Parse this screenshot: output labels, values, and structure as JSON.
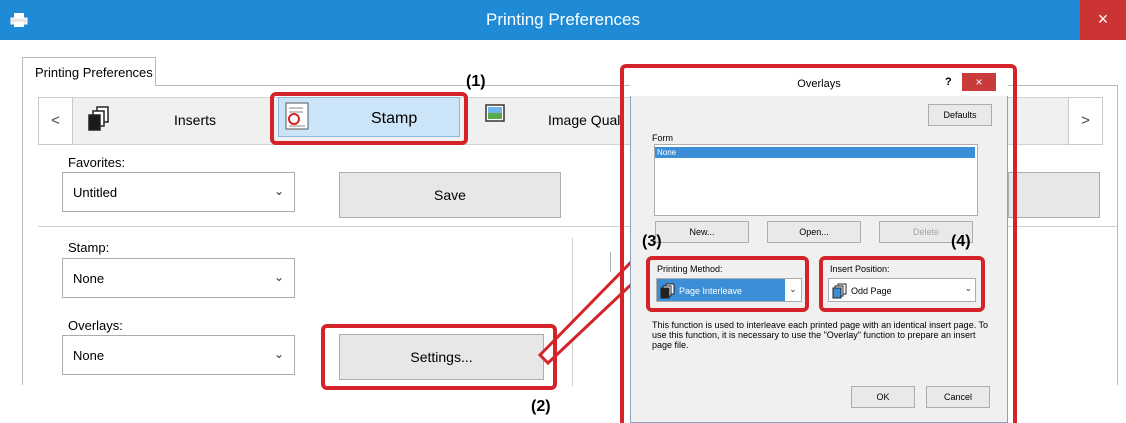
{
  "window": {
    "title": "Printing Preferences",
    "close_glyph": "×"
  },
  "tab": {
    "label": "Printing Preferences"
  },
  "nav": {
    "prev_glyph": "<",
    "next_glyph": ">",
    "items": [
      {
        "label": "Inserts",
        "icon": "inserts-icon"
      },
      {
        "label": "Stamp",
        "icon": "stamp-icon"
      },
      {
        "label": "Image Qual",
        "icon": "image-quality-icon"
      }
    ]
  },
  "favorites": {
    "label": "Favorites:",
    "value": "Untitled",
    "save_label": "Save"
  },
  "stamp": {
    "label": "Stamp:",
    "value": "None"
  },
  "overlays": {
    "label": "Overlays:",
    "value": "None",
    "settings_label": "Settings..."
  },
  "callouts": [
    "(1)",
    "(2)",
    "(3)",
    "(4)"
  ],
  "dialog": {
    "title": "Overlays",
    "help_glyph": "?",
    "close_glyph": "×",
    "defaults_label": "Defaults",
    "form_label": "Form",
    "form_items": [
      "None"
    ],
    "new_label": "New...",
    "open_label": "Open...",
    "delete_label": "Delete",
    "printing_method_label": "Printing Method:",
    "printing_method_value": "Page Interleave",
    "insert_position_label": "Insert Position:",
    "insert_position_value": "Odd Page",
    "description": "This function is used to interleave each printed page with an identical insert page. To use this function, it is necessary to use the \"Overlay\" function to prepare an insert page file.",
    "ok_label": "OK",
    "cancel_label": "Cancel"
  },
  "colors": {
    "titlebar": "#1f8bd6",
    "callout": "#d4242a",
    "selection": "#3c8fd7",
    "close": "#cc3333"
  }
}
